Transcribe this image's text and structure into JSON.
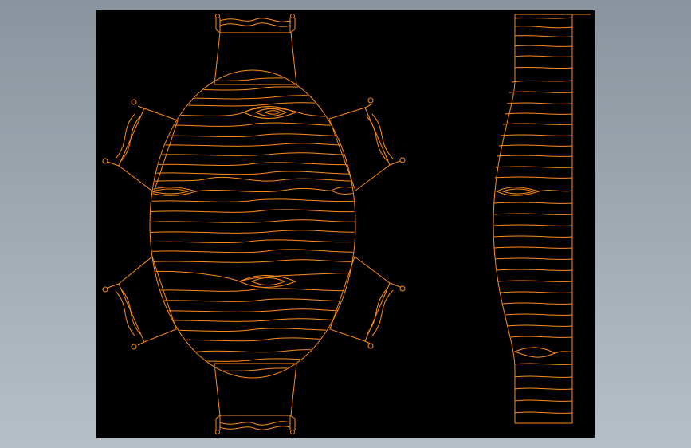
{
  "colors": {
    "background_top": "#8a949e",
    "background_bottom": "#b7bfc6",
    "canvas": "#000000",
    "stroke": "#ff8c1a"
  },
  "drawing": {
    "plan_view": {
      "table_shape": "oval",
      "chair_count": 6
    },
    "side_view": {
      "shape": "table-profile"
    }
  }
}
